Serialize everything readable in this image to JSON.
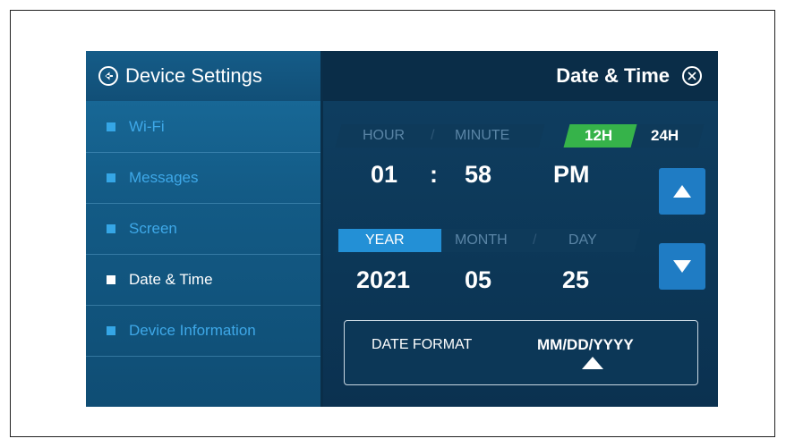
{
  "sidebar": {
    "title": "Device Settings",
    "items": [
      {
        "label": "Wi-Fi"
      },
      {
        "label": "Messages"
      },
      {
        "label": "Screen"
      },
      {
        "label": "Date & Time"
      },
      {
        "label": "Device Information"
      }
    ]
  },
  "header": {
    "title": "Date & Time"
  },
  "time": {
    "hour_label": "HOUR",
    "minute_label": "MINUTE",
    "separator": "/",
    "hour": "01",
    "colon": ":",
    "minute": "58",
    "ampm": "PM",
    "format_12h": "12H",
    "format_24h": "24H",
    "selected_format": "12H"
  },
  "date": {
    "year_label": "YEAR",
    "month_label": "MONTH",
    "day_label": "DAY",
    "separator": "/",
    "year": "2021",
    "month": "05",
    "day": "25"
  },
  "date_format": {
    "label": "DATE FORMAT",
    "value": "MM/DD/YYYY"
  },
  "colors": {
    "accent": "#2390d6",
    "toggle_active": "#36b34a",
    "sidebar_text": "#3ea8e8"
  },
  "icons": [
    "back-arrow-icon",
    "close-icon",
    "up-arrow-icon",
    "down-arrow-icon",
    "caret-up-icon"
  ]
}
